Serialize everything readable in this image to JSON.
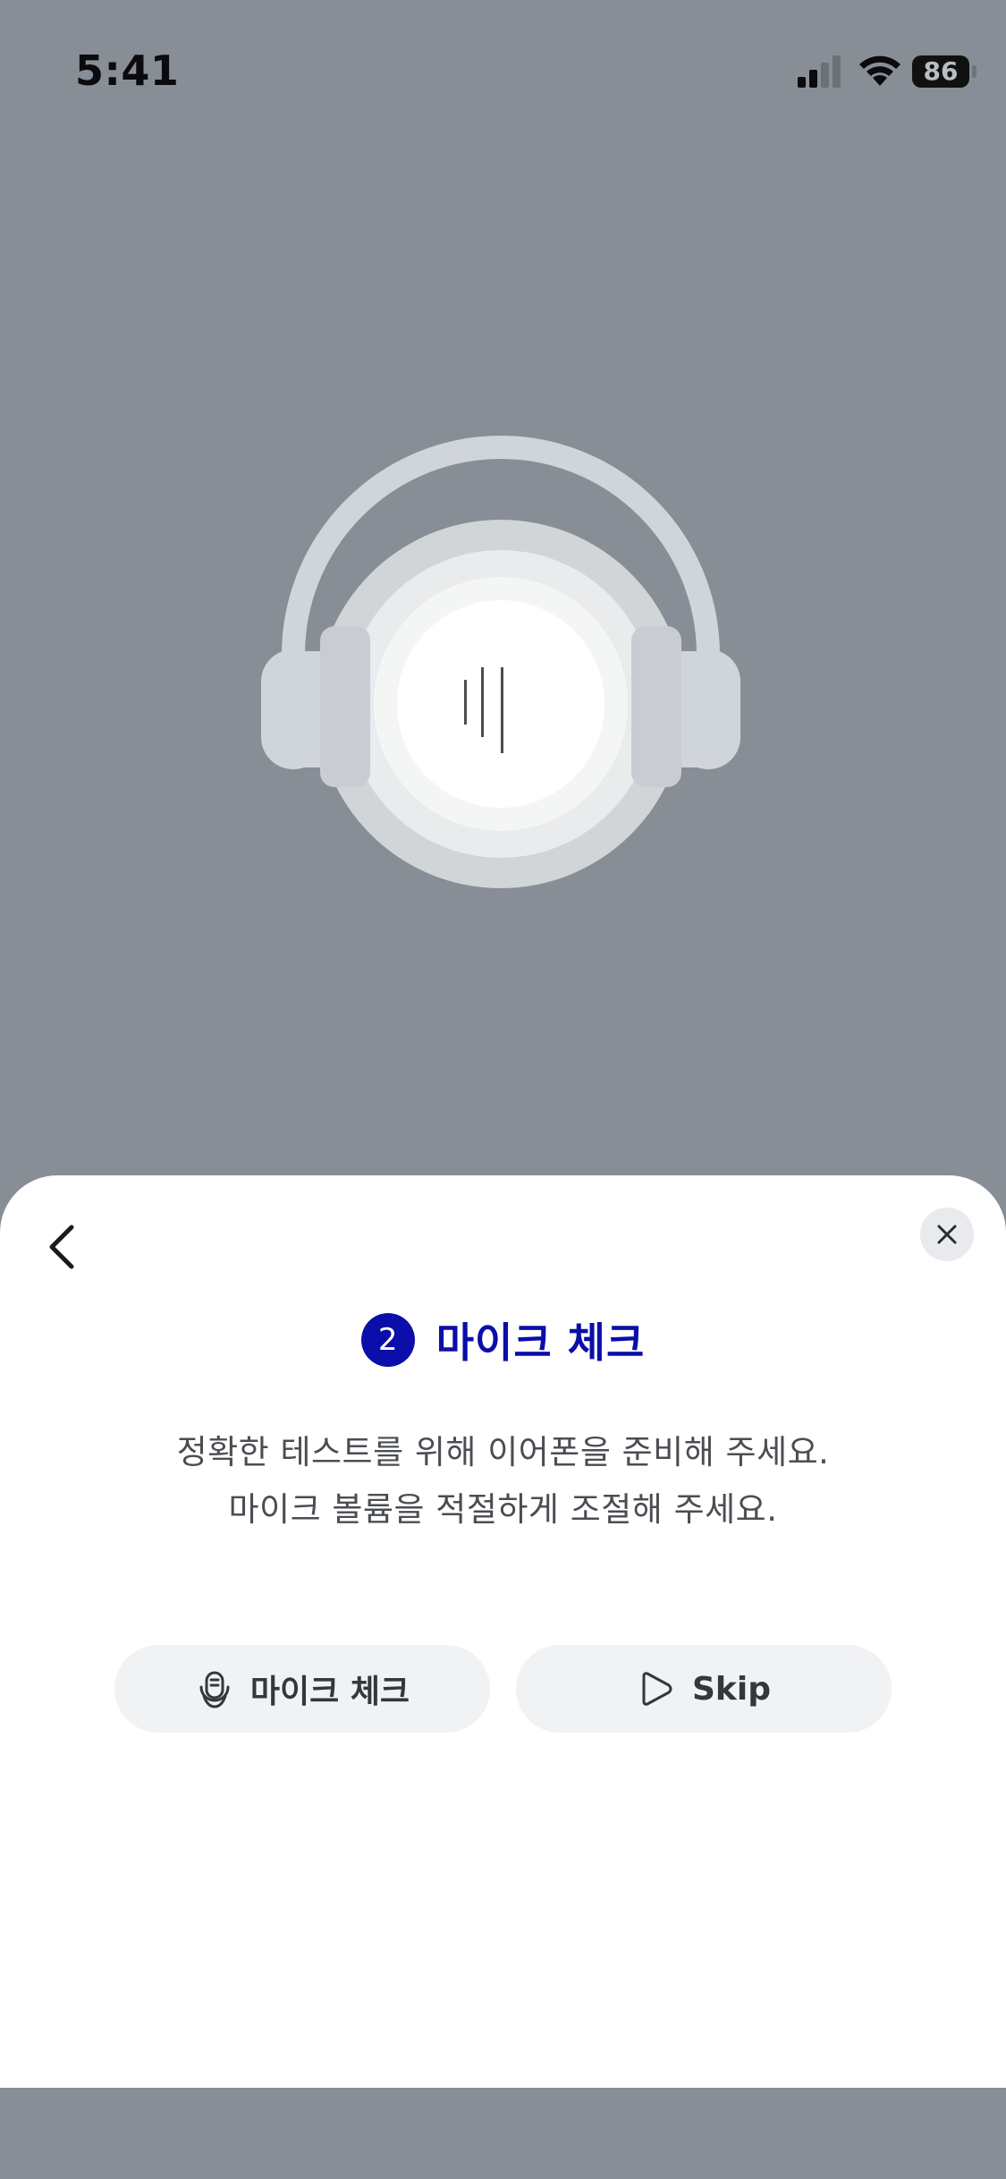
{
  "status_bar": {
    "time": "5:41",
    "battery_level": "86",
    "signal_icon": "cellular-signal-icon",
    "wifi_icon": "wifi-icon"
  },
  "illustration": {
    "icon": "headphones-sound-icon"
  },
  "sheet": {
    "back_icon": "chevron-left-icon",
    "close_icon": "close-icon",
    "step_number": "2",
    "title": "마이크 체크",
    "description_lines": [
      "정확한 테스트를 위해 이어폰을 준비해 주세요.",
      "마이크 볼륨을 적절하게 조절해 주세요."
    ],
    "buttons": [
      {
        "label": "마이크 체크",
        "icon": "microphone-icon"
      },
      {
        "label": "Skip",
        "icon": "play-outline-icon"
      }
    ]
  },
  "colors": {
    "overlay": "#888e96",
    "accent": "#0b0ea8",
    "button_bg": "#f1f2f4",
    "text_primary": "#34373c"
  }
}
